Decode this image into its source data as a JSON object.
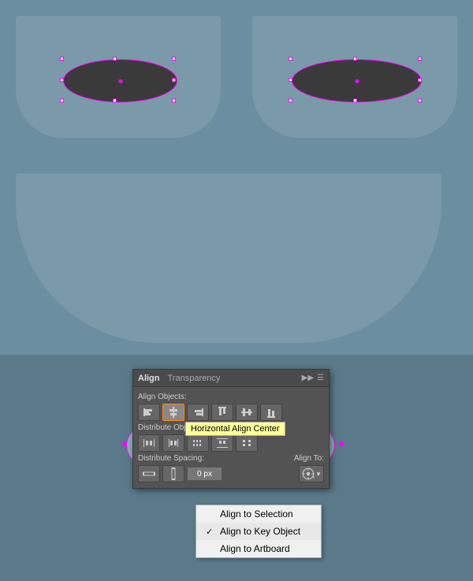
{
  "canvas": {
    "bg_color": "#6b8fa0"
  },
  "panel": {
    "title": "Align",
    "tab2": "Transparency",
    "sections": {
      "align_objects": "Align Objects:",
      "distribute_objects": "Distribute Objects:",
      "distribute_spacing": "Distribute Spacing:",
      "align_to": "Align To:"
    },
    "tooltip": "Horizontal Align Center",
    "spacing_value": "0 px"
  },
  "dropdown": {
    "items": [
      {
        "label": "Align to Selection",
        "checked": false
      },
      {
        "label": "Align to Key Object",
        "checked": true
      },
      {
        "label": "Align to Artboard",
        "checked": false
      }
    ]
  },
  "icons": {
    "align_left": "⊢",
    "align_center_h": "⊣",
    "align_right": "⊣",
    "align_top": "⊤",
    "align_center_v": "⊥",
    "align_bottom": "⊥"
  }
}
